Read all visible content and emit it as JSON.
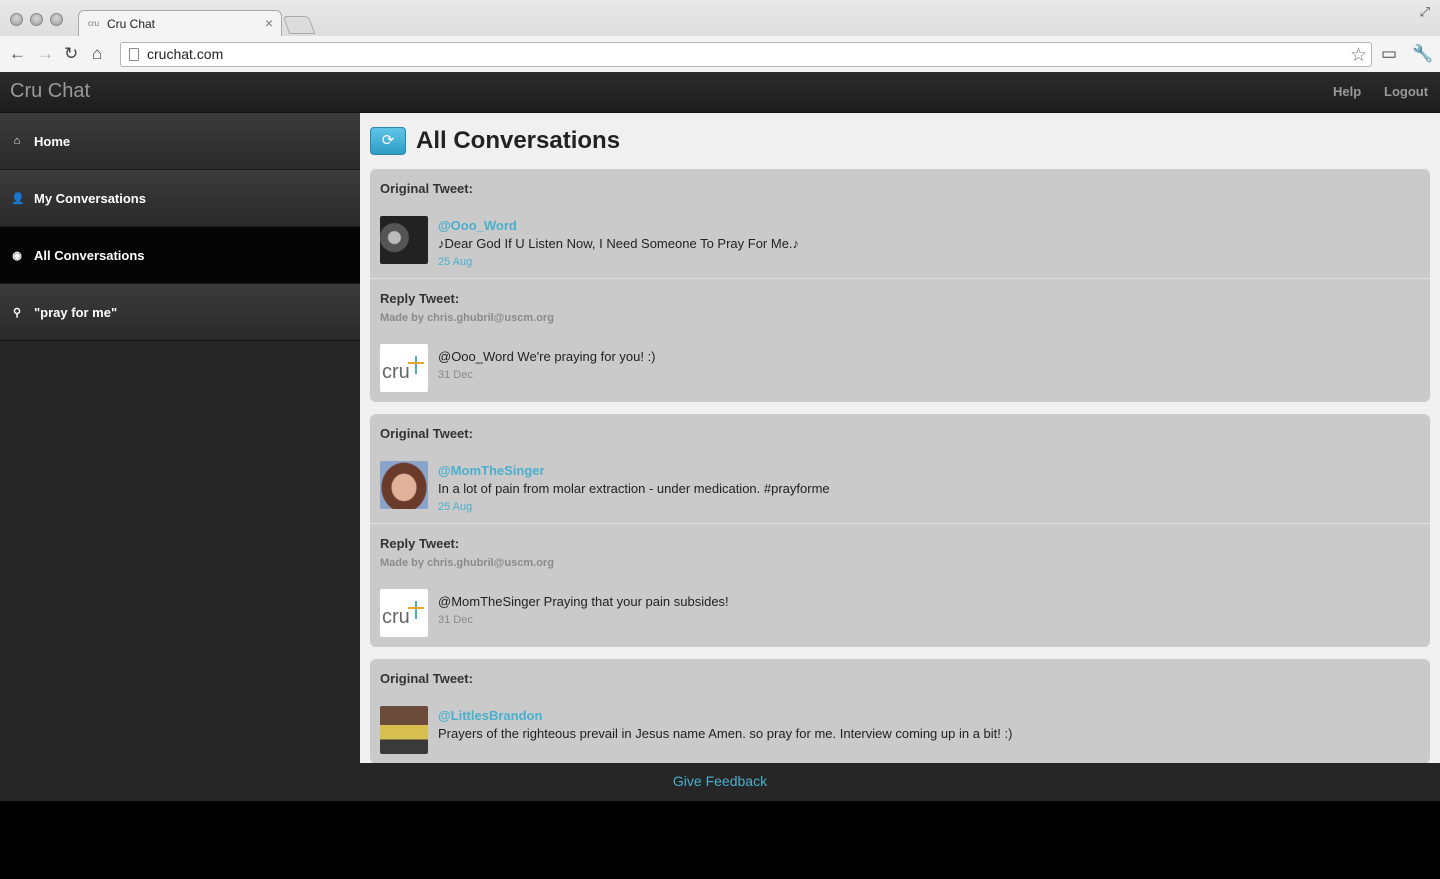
{
  "browser": {
    "tab_title": "Cru Chat",
    "tab_favicon": "cru",
    "tab_close": "×",
    "url": "cruchat.com"
  },
  "navbar": {
    "brand": "Cru Chat",
    "help": "Help",
    "logout": "Logout"
  },
  "sidebar": {
    "items": [
      {
        "label": "Home",
        "icon": "home-icon",
        "glyph": "⌂"
      },
      {
        "label": "My Conversations",
        "icon": "user-icon",
        "glyph": "👤"
      },
      {
        "label": "All Conversations",
        "icon": "globe-icon",
        "glyph": "◉"
      },
      {
        "label": "\"pray for me\"",
        "icon": "search-icon",
        "glyph": "⚲"
      }
    ],
    "active_index": 2
  },
  "main": {
    "title": "All Conversations",
    "refresh_glyph": "⟳",
    "original_label": "Original Tweet:",
    "reply_label": "Reply Tweet:",
    "conversations": [
      {
        "original": {
          "handle": "@Ooo_Word",
          "text": "♪Dear God If U Listen Now, I Need Someone To Pray For Me.♪",
          "date": "25 Aug"
        },
        "reply": {
          "made_by": "Made by chris.ghubril@uscm.org",
          "text": "@Ooo_Word We're praying for you! :)",
          "date": "31 Dec"
        }
      },
      {
        "original": {
          "handle": "@MomTheSinger",
          "text": "In a lot of pain from molar extraction - under medication. #prayforme",
          "date": "25 Aug"
        },
        "reply": {
          "made_by": "Made by chris.ghubril@uscm.org",
          "text": "@MomTheSinger Praying that your pain subsides!",
          "date": "31 Dec"
        }
      },
      {
        "original": {
          "handle": "@LittlesBrandon",
          "text": "Prayers of the righteous prevail in Jesus name Amen. so pray for me. Interview coming up in a bit! :)"
        }
      }
    ],
    "cru_logo_text": "cru"
  },
  "footer": {
    "feedback": "Give Feedback"
  }
}
